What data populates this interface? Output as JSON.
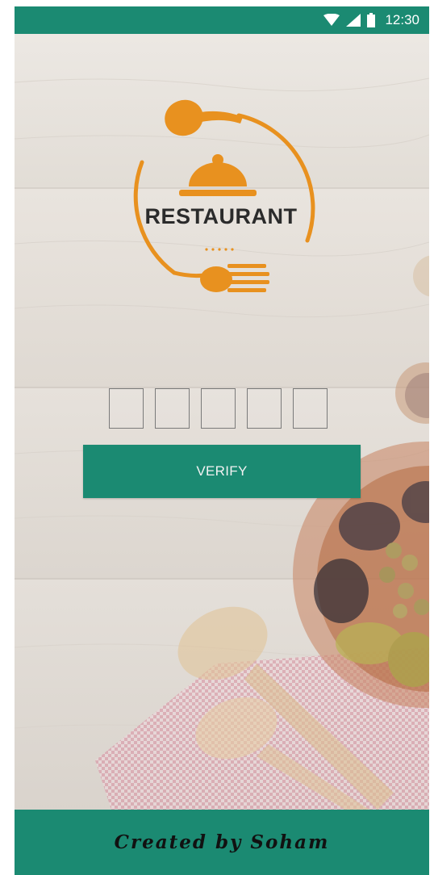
{
  "status_bar": {
    "time": "12:30",
    "icons": [
      "wifi-icon",
      "signal-icon",
      "battery-icon"
    ]
  },
  "logo": {
    "text": "RESTAURANT",
    "dots": "• • • • •"
  },
  "verification": {
    "code_length": 5,
    "code_values": [
      "",
      "",
      "",
      "",
      ""
    ]
  },
  "verify_button": {
    "label": "VERIFY"
  },
  "footer": {
    "credit": "Created by Soham"
  },
  "colors": {
    "primary": "#1b8a72",
    "logo_orange": "#e8911f",
    "text_dark": "#2b2b2b"
  }
}
